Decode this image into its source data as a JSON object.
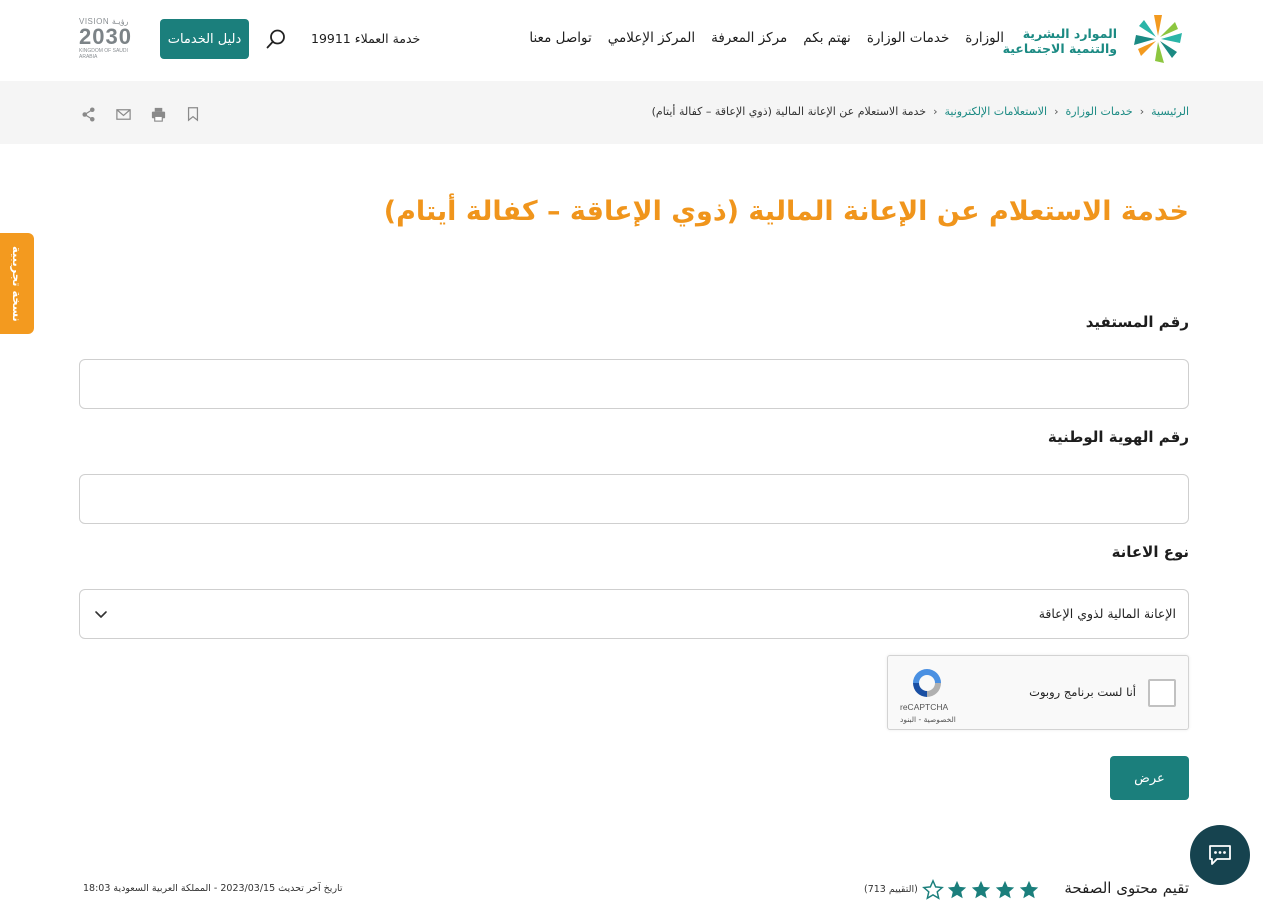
{
  "header": {
    "logo": {
      "line1": "الموارد البشرية",
      "line2": "والتنمية الاجتماعية",
      "icon": "ministry-logo-icon"
    },
    "nav": [
      "الوزارة",
      "خدمات الوزارة",
      "نهتم بكم",
      "مركز المعرفة",
      "المركز الإعلامي",
      "تواصل معنا"
    ],
    "hotline": "خدمة العملاء 19911",
    "search_icon": "search-icon",
    "guide_button": "دليل الخدمات",
    "vision": {
      "top": "VISION رؤيـة",
      "year": "2030",
      "sub": "KINGDOM OF SAUDI ARABIA"
    }
  },
  "breadcrumb": {
    "items": [
      "الرئيسية",
      "خدمات الوزارة",
      "الاستعلامات الإلكترونية"
    ],
    "current": "خدمة الاستعلام عن الإعانة المالية (ذوي الإعاقة – كفالة أيتام)"
  },
  "tools": [
    "bookmark-icon",
    "print-icon",
    "mail-icon",
    "share-icon"
  ],
  "side_tab": "نسخة تجريبية",
  "page_title": "خدمة الاستعلام عن الإعانة المالية (ذوي الإعاقة – كفالة أيتام)",
  "form": {
    "beneficiary_label": "رقم المستفيد",
    "beneficiary_value": "",
    "national_id_label": "رقم الهوية الوطنية",
    "national_id_value": "",
    "aid_type_label": "نوع الاعانة",
    "aid_type_value": "الإعانة المالية لذوي الإعاقة",
    "captcha": {
      "label": "أنا لست برنامج روبوت",
      "brand": "reCAPTCHA",
      "terms": "الخصوصية - البنود"
    },
    "submit_label": "عرض"
  },
  "rating": {
    "label": "تقيم محتوى الصفحة",
    "stars_filled": 4,
    "stars_total": 5,
    "count": "(التقييم 713)"
  },
  "last_update": "تاريخ آخر تحديث  2023/03/15  -  المملكة العربية السعودية  18:03",
  "colors": {
    "primary": "#1b7f7c",
    "accent": "#f0951c",
    "chat": "#16434f"
  }
}
